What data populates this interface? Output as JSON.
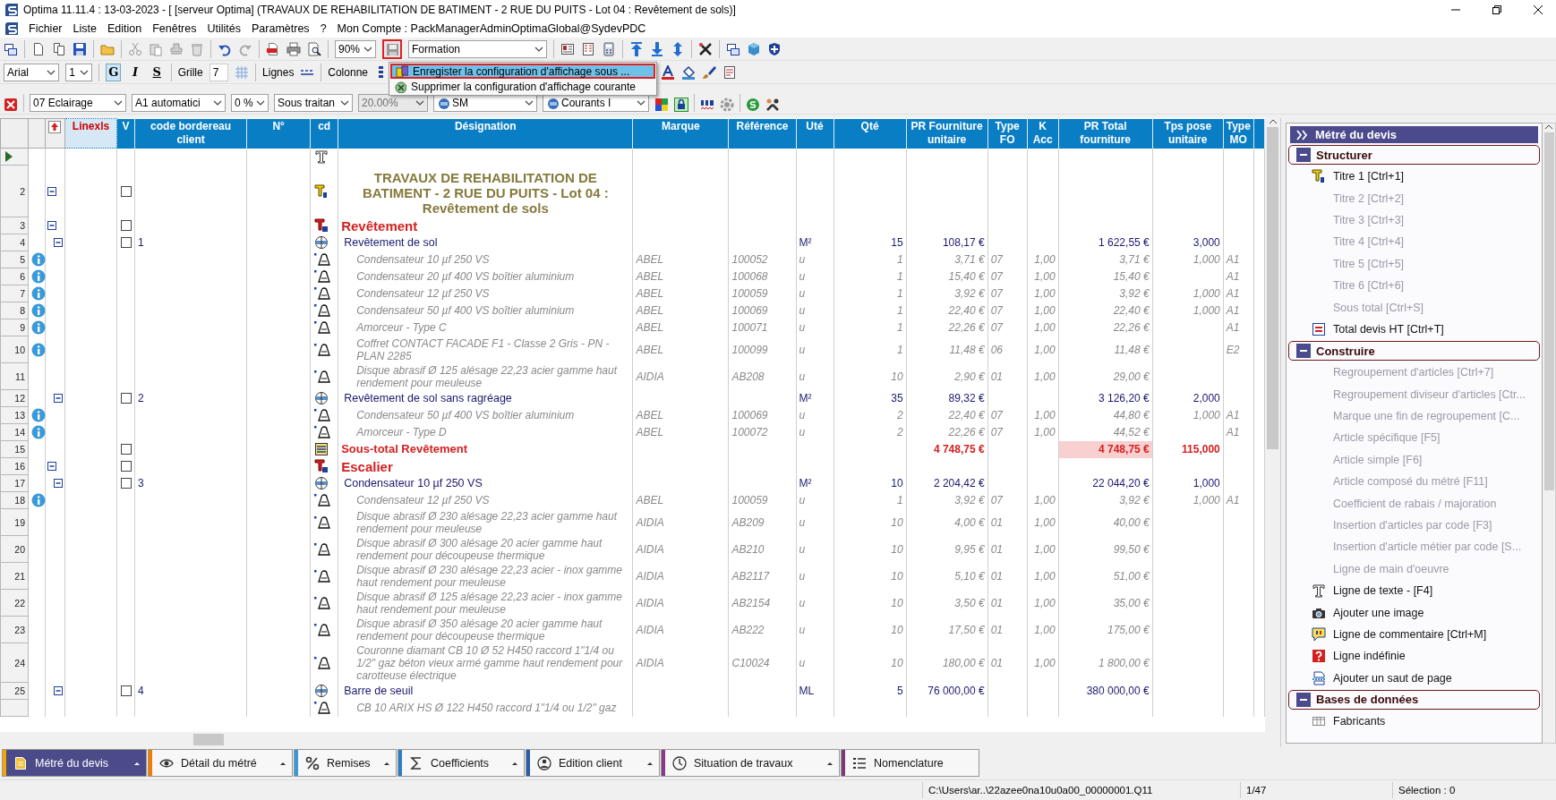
{
  "window": {
    "title": "Optima 11.11.4 : 13-03-2023 - [ [serveur Optima] (TRAVAUX DE REHABILITATION DE BATIMENT - 2 RUE DU PUITS - Lot 04 : Revêtement de sols)]"
  },
  "menu": {
    "items": [
      "Fichier",
      "Liste",
      "Edition",
      "Fenêtres",
      "Utilités",
      "Paramètres",
      "?"
    ],
    "account": "Mon Compte : PackManagerAdminOptimaGlobal@SydevPDC"
  },
  "toolbar": {
    "zoom": "90%",
    "config": "Formation",
    "font": "Arial",
    "font_size": "1",
    "style_buttons": [
      {
        "label": "G",
        "pressed": true
      },
      {
        "label": "I",
        "pressed": false
      },
      {
        "label": "S",
        "pressed": false
      }
    ],
    "grid_label": "Grille",
    "grid_value": "7",
    "lines_label": "Lignes",
    "column_label": "Colonne"
  },
  "config_menu": {
    "items": [
      {
        "label": "Enregister la configuration d'affichage sous ...",
        "selected": true
      },
      {
        "label": "Supprimer la configuration d'affichage courante",
        "selected": false
      }
    ]
  },
  "filters": [
    {
      "value": "07  Eclairage",
      "kind": "plain",
      "disabled": false
    },
    {
      "value": "A1  automatici",
      "kind": "plain",
      "disabled": false
    },
    {
      "value": "0 %",
      "kind": "plain",
      "disabled": false
    },
    {
      "value": "Sous traitan",
      "kind": "plain",
      "disabled": false
    },
    {
      "value": "20.00%",
      "kind": "plain",
      "disabled": true
    },
    {
      "value": "SM",
      "kind": "icon",
      "disabled": false
    },
    {
      "value": "Courants I",
      "kind": "icon",
      "disabled": false
    }
  ],
  "grid": {
    "columns": [
      "Linexls",
      "V",
      "code bordereau client",
      "N°",
      "cd",
      "Désignation",
      "Marque",
      "Référence",
      "Uté",
      "Qté",
      "PR Fourniture unitaire",
      "Type FO",
      "K Acc",
      "PR Total fourniture",
      "Tps pose unitaire",
      "Type MO"
    ],
    "rows": [
      {
        "kind": "text",
        "current": true
      },
      {
        "n": "2",
        "kind": "title1",
        "current": false,
        "expanded": true,
        "checked": false,
        "designation": "TRAVAUX DE REHABILITATION DE BATIMENT - 2 RUE DU PUITS  - Lot 04 : Revêtement de sols"
      },
      {
        "n": "3",
        "kind": "title2",
        "current": false,
        "expanded": true,
        "checked": false,
        "designation": "Revêtement"
      },
      {
        "n": "4",
        "kind": "ouvrage",
        "current": false,
        "expanded": true,
        "checked": false,
        "code": "1",
        "designation": "Revêtement de sol",
        "ute": "M²",
        "qte": "15",
        "pru": "108,17 €",
        "prt": "1 622,55 €",
        "tps": "3,000"
      },
      {
        "n": "5",
        "kind": "article",
        "current": false,
        "info": true,
        "designation": "Condensateur 10 µf 250 VS",
        "marque": "ABEL",
        "reference": "100052",
        "ute": "u",
        "qte": "1",
        "pru": "3,71 €",
        "type_fo": "07",
        "k_acc": "1,00",
        "prt": "3,71 €",
        "tps": "1,000",
        "type_mo": "A1"
      },
      {
        "n": "6",
        "kind": "article",
        "current": false,
        "info": true,
        "designation": "Condensateur 20 µf 400 VS boîtier aluminium",
        "marque": "ABEL",
        "reference": "100068",
        "ute": "u",
        "qte": "1",
        "pru": "15,40 €",
        "type_fo": "07",
        "k_acc": "1,00",
        "prt": "15,40 €",
        "type_mo": "A1"
      },
      {
        "n": "7",
        "kind": "article",
        "current": false,
        "info": true,
        "designation": "Condensateur 12 µf 250 VS",
        "marque": "ABEL",
        "reference": "100059",
        "ute": "u",
        "qte": "1",
        "pru": "3,92 €",
        "type_fo": "07",
        "k_acc": "1,00",
        "prt": "3,92 €",
        "tps": "1,000",
        "type_mo": "A1"
      },
      {
        "n": "8",
        "kind": "article",
        "current": false,
        "info": true,
        "designation": "Condensateur 50 µf 400 VS boîtier aluminium",
        "marque": "ABEL",
        "reference": "100069",
        "ute": "u",
        "qte": "1",
        "pru": "22,40 €",
        "type_fo": "07",
        "k_acc": "1,00",
        "prt": "22,40 €",
        "tps": "1,000",
        "type_mo": "A1"
      },
      {
        "n": "9",
        "kind": "article",
        "current": false,
        "info": true,
        "designation": "Amorceur  - Type C",
        "marque": "ABEL",
        "reference": "100071",
        "ute": "u",
        "qte": "1",
        "pru": "22,26 €",
        "type_fo": "07",
        "k_acc": "1,00",
        "prt": "22,26 €",
        "type_mo": "A1"
      },
      {
        "n": "10",
        "kind": "article",
        "current": false,
        "info": true,
        "designation": "Coffret CONTACT FACADE F1 - Classe 2 Gris - PN - PLAN 2285",
        "marque": "ABEL",
        "reference": "100099",
        "ute": "u",
        "qte": "1",
        "pru": "11,48 €",
        "type_fo": "06",
        "k_acc": "1,00",
        "prt": "11,48 €",
        "type_mo": "E2"
      },
      {
        "n": "11",
        "kind": "article",
        "current": false,
        "info": false,
        "designation": "Disque abrasif Ø 125 alésage 22,23 acier gamme haut rendement pour meuleuse",
        "marque": "AIDIA",
        "reference": "AB208",
        "ute": "u",
        "qte": "10",
        "pru": "2,90 €",
        "type_fo": "01",
        "k_acc": "1,00",
        "prt": "29,00 €"
      },
      {
        "n": "12",
        "kind": "ouvrage",
        "current": false,
        "expanded": true,
        "checked": false,
        "code": "2",
        "designation": "Revêtement de sol sans ragréage",
        "ute": "M²",
        "qte": "35",
        "pru": "89,32 €",
        "prt": "3 126,20 €",
        "tps": "2,000"
      },
      {
        "n": "13",
        "kind": "article",
        "current": false,
        "info": true,
        "designation": "Condensateur 50 µf 400 VS boîtier aluminium",
        "marque": "ABEL",
        "reference": "100069",
        "ute": "u",
        "qte": "2",
        "pru": "22,40 €",
        "type_fo": "07",
        "k_acc": "1,00",
        "prt": "44,80 €",
        "tps": "1,000",
        "type_mo": "A1"
      },
      {
        "n": "14",
        "kind": "article",
        "current": false,
        "info": true,
        "designation": "Amorceur  - Type D",
        "marque": "ABEL",
        "reference": "100072",
        "ute": "u",
        "qte": "2",
        "pru": "22,26 €",
        "type_fo": "07",
        "k_acc": "1,00",
        "prt": "44,52 €",
        "type_mo": "A1"
      },
      {
        "n": "15",
        "kind": "subtotal",
        "current": false,
        "checked": false,
        "designation": "Sous-total Revêtement",
        "pru": "4 748,75 €",
        "prt": "4 748,75 €",
        "tps": "115,000"
      },
      {
        "n": "16",
        "kind": "title2",
        "current": false,
        "expanded": true,
        "checked": false,
        "designation": "Escalier"
      },
      {
        "n": "17",
        "kind": "ouvrage",
        "current": false,
        "expanded": true,
        "checked": false,
        "code": "3",
        "designation": "Condensateur 10 µf 250 VS",
        "ute": "M²",
        "qte": "10",
        "pru": "2 204,42 €",
        "prt": "22 044,20 €",
        "tps": "1,000"
      },
      {
        "n": "18",
        "kind": "article",
        "current": false,
        "info": true,
        "designation": "Condensateur 12 µf 250 VS",
        "marque": "ABEL",
        "reference": "100059",
        "ute": "u",
        "qte": "1",
        "pru": "3,92 €",
        "type_fo": "07",
        "k_acc": "1,00",
        "prt": "3,92 €",
        "tps": "1,000",
        "type_mo": "A1"
      },
      {
        "n": "19",
        "kind": "article",
        "current": false,
        "info": false,
        "designation": "Disque abrasif Ø 230 alésage 22,23 acier gamme haut rendement pour meuleuse",
        "marque": "AIDIA",
        "reference": "AB209",
        "ute": "u",
        "qte": "10",
        "pru": "4,00 €",
        "type_fo": "01",
        "k_acc": "1,00",
        "prt": "40,00 €"
      },
      {
        "n": "20",
        "kind": "article",
        "current": false,
        "info": false,
        "designation": "Disque abrasif Ø 300 alésage 20 acier gamme haut rendement pour découpeuse thermique",
        "marque": "AIDIA",
        "reference": "AB210",
        "ute": "u",
        "qte": "10",
        "pru": "9,95 €",
        "type_fo": "01",
        "k_acc": "1,00",
        "prt": "99,50 €"
      },
      {
        "n": "21",
        "kind": "article",
        "current": false,
        "info": false,
        "designation": "Disque abrasif Ø 230 alésage 22,23 acier - inox gamme haut rendement pour meuleuse",
        "marque": "AIDIA",
        "reference": "AB2117",
        "ute": "u",
        "qte": "10",
        "pru": "5,10 €",
        "type_fo": "01",
        "k_acc": "1,00",
        "prt": "51,00 €"
      },
      {
        "n": "22",
        "kind": "article",
        "current": false,
        "info": false,
        "designation": "Disque abrasif Ø 125 alésage 22,23 acier - inox gamme haut rendement pour meuleuse",
        "marque": "AIDIA",
        "reference": "AB2154",
        "ute": "u",
        "qte": "10",
        "pru": "3,50 €",
        "type_fo": "01",
        "k_acc": "1,00",
        "prt": "35,00 €"
      },
      {
        "n": "23",
        "kind": "article",
        "current": false,
        "info": false,
        "designation": "Disque abrasif Ø 350 alésage 20 acier gamme haut rendement pour découpeuse thermique",
        "marque": "AIDIA",
        "reference": "AB222",
        "ute": "u",
        "qte": "10",
        "pru": "17,50 €",
        "type_fo": "01",
        "k_acc": "1,00",
        "prt": "175,00 €"
      },
      {
        "n": "24",
        "kind": "article",
        "current": false,
        "info": false,
        "designation": "Couronne diamant CB 10 Ø 52 H450 raccord 1\"1/4 ou 1/2\" gaz béton vieux armé gamme haut rendement pour carotteuse électrique",
        "marque": "AIDIA",
        "reference": "C10024",
        "ute": "u",
        "qte": "10",
        "pru": "180,00 €",
        "type_fo": "01",
        "k_acc": "1,00",
        "prt": "1 800,00 €"
      },
      {
        "n": "25",
        "kind": "ouvrage",
        "current": false,
        "expanded": true,
        "checked": false,
        "code": "4",
        "designation": "Barre de seuil",
        "ute": "ML",
        "qte": "5",
        "pru": "76 000,00 €",
        "prt": "380 000,00 €"
      },
      {
        "kind": "article",
        "current": false,
        "info": false,
        "designation": "CB 10 ARIX HS Ø 122 H450 raccord 1\"1/4 ou 1/2\" gaz"
      }
    ]
  },
  "panel": {
    "title": "Métré du devis",
    "groups": [
      {
        "label": "Structurer",
        "expanded": true,
        "items": [
          {
            "label": "Titre 1 [Ctrl+1]",
            "kind": "title1",
            "disabled": false
          },
          {
            "label": "Titre 2 [Ctrl+2]",
            "kind": "none",
            "disabled": true
          },
          {
            "label": "Titre 3 [Ctrl+3]",
            "kind": "none",
            "disabled": true
          },
          {
            "label": "Titre 4 [Ctrl+4]",
            "kind": "none",
            "disabled": true
          },
          {
            "label": "Titre 5 [Ctrl+5]",
            "kind": "none",
            "disabled": true
          },
          {
            "label": "Titre 6 [Ctrl+6]",
            "kind": "none",
            "disabled": true
          },
          {
            "label": "Sous total [Ctrl+S]",
            "kind": "none",
            "disabled": true
          },
          {
            "label": "Total devis HT [Ctrl+T]",
            "kind": "total",
            "disabled": false
          }
        ]
      },
      {
        "label": "Construire",
        "expanded": true,
        "items": [
          {
            "label": "Regroupement d'articles  [Ctrl+7]",
            "kind": "none",
            "disabled": true
          },
          {
            "label": "Regroupement diviseur d'articles [Ctr...",
            "kind": "none",
            "disabled": true
          },
          {
            "label": "Marque une fin de regroupement  [C...",
            "kind": "none",
            "disabled": true
          },
          {
            "label": "Article spécifique [F5]",
            "kind": "none",
            "disabled": true
          },
          {
            "label": "Article simple [F6]",
            "kind": "none",
            "disabled": true
          },
          {
            "label": "Article composé du métré [F11]",
            "kind": "none",
            "disabled": true
          },
          {
            "label": "Coefficient de rabais / majoration",
            "kind": "none",
            "disabled": true
          },
          {
            "label": "Insertion d'articles par code [F3]",
            "kind": "none",
            "disabled": true
          },
          {
            "label": "Insertion d'article métier par code [S...",
            "kind": "none",
            "disabled": true
          },
          {
            "label": "Ligne de main d'oeuvre",
            "kind": "none",
            "disabled": true
          },
          {
            "label": "Ligne de texte - [F4]",
            "kind": "text",
            "disabled": false
          },
          {
            "label": "Ajouter une image",
            "kind": "camera",
            "disabled": false
          },
          {
            "label": "Ligne de commentaire [Ctrl+M]",
            "kind": "comment",
            "disabled": false
          },
          {
            "label": "Ligne indéfinie",
            "kind": "question",
            "disabled": false
          },
          {
            "label": "Ajouter un saut de page",
            "kind": "pagebreak",
            "disabled": false
          }
        ]
      },
      {
        "label": "Bases de données",
        "expanded": true,
        "items": [
          {
            "label": "Fabricants",
            "kind": "table",
            "disabled": false
          }
        ]
      }
    ]
  },
  "tabs": [
    {
      "label": "Métré du devis",
      "kind": "document",
      "color": "#f0a800",
      "selected": true,
      "dropdown": true
    },
    {
      "label": "Détail du métré",
      "kind": "eye",
      "color": "#f07c00",
      "selected": false,
      "dropdown": true
    },
    {
      "label": "Remises",
      "kind": "percent",
      "color": "#3a9ad9",
      "selected": false,
      "dropdown": true
    },
    {
      "label": "Coefficients",
      "kind": "sigma",
      "color": "#2f7fc8",
      "selected": false,
      "dropdown": true
    },
    {
      "label": "Edition client",
      "kind": "person",
      "color": "#2a5ea8",
      "selected": false,
      "dropdown": true
    },
    {
      "label": "Situation de travaux",
      "kind": "clock",
      "color": "#8a3a8a",
      "selected": false,
      "dropdown": true
    },
    {
      "label": "Nomenclature",
      "kind": "list",
      "color": "#7a3a7a",
      "selected": false,
      "dropdown": false
    }
  ],
  "status_bar": {
    "path": "C:\\Users\\ar..\\22azee0na10u0a00_00000001.Q11",
    "page": "1/47",
    "selection": "Sélection : 0"
  }
}
